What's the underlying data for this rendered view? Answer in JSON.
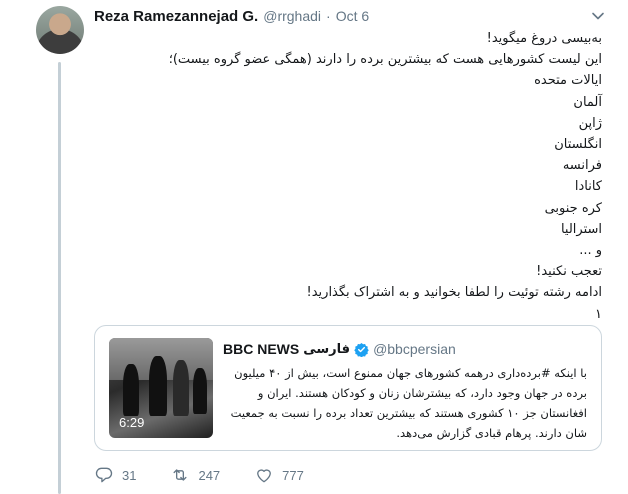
{
  "tweet": {
    "author_name": "Reza Ramezannejad G.",
    "handle": "@rrghadi",
    "separator": "·",
    "date": "Oct 6",
    "lines": [
      "بەبیسی دروغ میگوید!",
      "این لیست کشورهایی هست که بیشترین برده را دارند (همگی عضو گروه بیست)؛",
      "ایالات متحده",
      "آلمان",
      "ژاپن",
      "انگلستان",
      "فرانسه",
      "کانادا",
      "کره جنوبی",
      "استرالیا",
      "و ...",
      "تعجب نکنید!",
      "ادامه رشته توئیت را لطفا بخوانید و به اشتراک بگذارید!",
      "۱"
    ]
  },
  "quote": {
    "name": "BBC NEWS",
    "name_fa": "فارسی",
    "handle": "@bbcpersian",
    "duration": "6:29",
    "lines": [
      "با اینکه #برده‌داری درهمه کشورهای جهان ممنوع است، بیش از ۴۰ میلیون",
      "برده در جهان وجود دارد، که بیشترشان زنان و کودکان هستند. ایران و",
      "افغانستان جز ۱۰ کشوری هستند که بیشترین تعداد برده را نسبت به جمعیت",
      "شان دارند. پرهام قبادی گزارش می‌دهد."
    ]
  },
  "actions": {
    "replies": "31",
    "retweets": "247",
    "likes": "777"
  },
  "colors": {
    "accent": "#1da1f2",
    "muted": "#657786",
    "border": "#ccd6dd"
  },
  "icons": [
    "chevron-down-icon",
    "verified-icon",
    "reply-icon",
    "retweet-icon",
    "like-icon"
  ]
}
